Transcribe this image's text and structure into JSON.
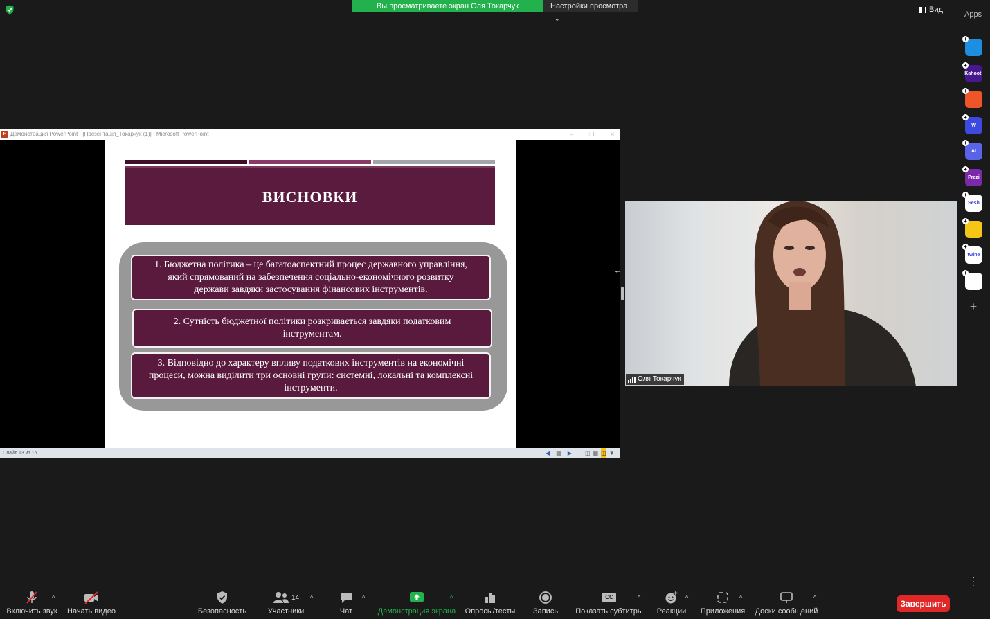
{
  "top_bar": {
    "viewing_banner": "Вы просматриваете экран Оля Токарчук",
    "view_settings": "Настройки просмотра",
    "view_button": "Вид",
    "apps_label": "Apps"
  },
  "ppt": {
    "title_bar": "Демонстрация PowerPoint - [Презентація_Токарчук (1)] - Microsoft PowerPoint",
    "slide_counter": "Слайд 13 из 16",
    "slide": {
      "title": "ВИСНОВКИ",
      "items": [
        "1.   Бюджетна політика – це багатоаспектний процес державного управління,\nякий спрямований на забезпечення соціально-економічного розвитку\nдержави завдяки застосування фінансових інструментів.",
        "2. Сутність бюджетної політики розкривається завдяки податковим\nінструментам.",
        "3. Відповідно до характеру впливу податкових інструментів на економічні\nпроцеси, можна виділити три основні групи: системні, локальні та комплексні\nінструменти."
      ]
    }
  },
  "video": {
    "participant_name": "Оля Токарчук"
  },
  "apps_sidebar": [
    {
      "icon": "pointer-app-icon",
      "text": "",
      "color": "#1e8ee0"
    },
    {
      "icon": "kahoot-icon",
      "text": "Kahoot!",
      "color": "#46178f"
    },
    {
      "icon": "orange-app-icon",
      "text": "",
      "color": "#f0552a"
    },
    {
      "icon": "wooclap-icon",
      "text": "W",
      "color": "#3d4ae0"
    },
    {
      "icon": "ai-app-icon",
      "text": "AI",
      "color": "#5a64e8"
    },
    {
      "icon": "prezi-icon",
      "text": "Prezi",
      "color": "#7a2aa8"
    },
    {
      "icon": "sesh-icon",
      "text": "Sesh",
      "color": "#ffffff"
    },
    {
      "icon": "emoji-app-icon",
      "text": "",
      "color": "#f5c518"
    },
    {
      "icon": "twine-icon",
      "text": "twine",
      "color": "#ffffff"
    },
    {
      "icon": "multicolor-app-icon",
      "text": "",
      "color": "#ffffff"
    }
  ],
  "toolbar": {
    "mute": "Включить звук",
    "video": "Начать видео",
    "security": "Безопасность",
    "participants": "Участники",
    "participants_count": "14",
    "chat": "Чат",
    "share_screen": "Демонстрация экрана",
    "polls": "Опросы/тесты",
    "record": "Запись",
    "captions": "Показать субтитры",
    "reactions": "Реакции",
    "apps": "Приложения",
    "whiteboards": "Доски сообщений",
    "end": "Завершить"
  },
  "colors": {
    "share_green": "#23b14d",
    "end_red": "#e02828",
    "slide_accent": "#5a1a3e"
  }
}
